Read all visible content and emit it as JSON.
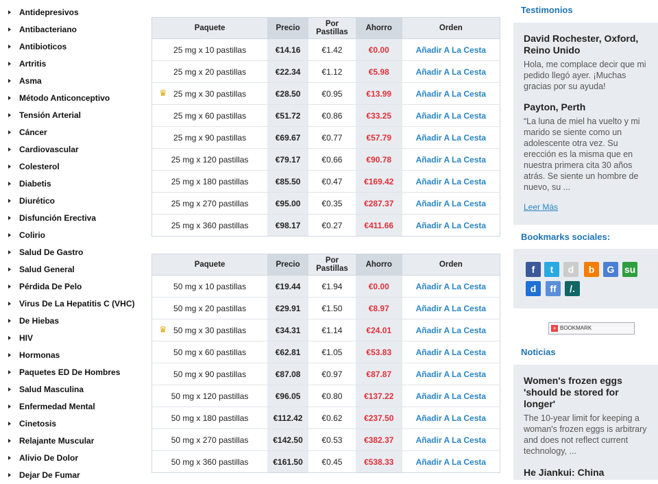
{
  "categories": [
    "Antidepresivos",
    "Antibacteriano",
    "Antibioticos",
    "Artritis",
    "Asma",
    "Método Anticonceptivo",
    "Tensión Arterial",
    "Cáncer",
    "Cardiovascular",
    "Colesterol",
    "Diabetis",
    "Diurético",
    "Disfunción Erectiva",
    "Colirio",
    "Salud De Gastro",
    "Salud General",
    "Pérdida De Pelo",
    "Virus De La Hepatitis C (VHC)",
    "De Hiebas",
    "HIV",
    "Hormonas",
    "Paquetes ED De Hombres",
    "Salud Masculina",
    "Enfermedad Mental",
    "Cinetosis",
    "Relajante Muscular",
    "Alivio De Dolor",
    "Dejar De Fumar"
  ],
  "table_headers": {
    "package": "Paquete",
    "price": "Precio",
    "per_pill": "Por Pastillas",
    "savings": "Ahorro",
    "order": "Orden"
  },
  "add_to_cart_label": "Añadir A La Cesta",
  "table1_rows": [
    {
      "package": "25 mg x 10 pastillas",
      "price": "€14.16",
      "per_pill": "€1.42",
      "savings": "€0.00",
      "crown": false
    },
    {
      "package": "25 mg x 20 pastillas",
      "price": "€22.34",
      "per_pill": "€1.12",
      "savings": "€5.98",
      "crown": false
    },
    {
      "package": "25 mg x 30 pastillas",
      "price": "€28.50",
      "per_pill": "€0.95",
      "savings": "€13.99",
      "crown": true
    },
    {
      "package": "25 mg x 60 pastillas",
      "price": "€51.72",
      "per_pill": "€0.86",
      "savings": "€33.25",
      "crown": false
    },
    {
      "package": "25 mg x 90 pastillas",
      "price": "€69.67",
      "per_pill": "€0.77",
      "savings": "€57.79",
      "crown": false
    },
    {
      "package": "25 mg x 120 pastillas",
      "price": "€79.17",
      "per_pill": "€0.66",
      "savings": "€90.78",
      "crown": false
    },
    {
      "package": "25 mg x 180 pastillas",
      "price": "€85.50",
      "per_pill": "€0.47",
      "savings": "€169.42",
      "crown": false
    },
    {
      "package": "25 mg x 270 pastillas",
      "price": "€95.00",
      "per_pill": "€0.35",
      "savings": "€287.37",
      "crown": false
    },
    {
      "package": "25 mg x 360 pastillas",
      "price": "€98.17",
      "per_pill": "€0.27",
      "savings": "€411.66",
      "crown": false
    }
  ],
  "table2_rows": [
    {
      "package": "50 mg x 10 pastillas",
      "price": "€19.44",
      "per_pill": "€1.94",
      "savings": "€0.00",
      "crown": false
    },
    {
      "package": "50 mg x 20 pastillas",
      "price": "€29.91",
      "per_pill": "€1.50",
      "savings": "€8.97",
      "crown": false
    },
    {
      "package": "50 mg x 30 pastillas",
      "price": "€34.31",
      "per_pill": "€1.14",
      "savings": "€24.01",
      "crown": true
    },
    {
      "package": "50 mg x 60 pastillas",
      "price": "€62.81",
      "per_pill": "€1.05",
      "savings": "€53.83",
      "crown": false
    },
    {
      "package": "50 mg x 90 pastillas",
      "price": "€87.08",
      "per_pill": "€0.97",
      "savings": "€87.87",
      "crown": false
    },
    {
      "package": "50 mg x 120 pastillas",
      "price": "€96.05",
      "per_pill": "€0.80",
      "savings": "€137.22",
      "crown": false
    },
    {
      "package": "50 mg x 180 pastillas",
      "price": "€112.42",
      "per_pill": "€0.62",
      "savings": "€237.50",
      "crown": false
    },
    {
      "package": "50 mg x 270 pastillas",
      "price": "€142.50",
      "per_pill": "€0.53",
      "savings": "€382.37",
      "crown": false
    },
    {
      "package": "50 mg x 360 pastillas",
      "price": "€161.50",
      "per_pill": "€0.45",
      "savings": "€538.33",
      "crown": false
    }
  ],
  "testimonials": {
    "heading": "Testimonios",
    "items": [
      {
        "name": "David Rochester, Oxford, Reino Unido",
        "text": "Hola, me complace decir que mi pedido llegó ayer. ¡Muchas gracias por su ayuda!"
      },
      {
        "name": "Payton, Perth",
        "text": "“La luna de miel ha vuelto y mi marido se siente como un adolescente otra vez. Su erección es la misma que en nuestra primera cita 30 años atrás. Se siente un hombre de nuevo, su ..."
      }
    ],
    "more_label": "Leer Más"
  },
  "social": {
    "heading": "Bookmarks sociales:",
    "icons": [
      {
        "name": "facebook-icon",
        "glyph": "f",
        "color": "#3b5998"
      },
      {
        "name": "twitter-icon",
        "glyph": "t",
        "color": "#29a9e1"
      },
      {
        "name": "digg-icon",
        "glyph": "d",
        "color": "#cccccc"
      },
      {
        "name": "blogger-icon",
        "glyph": "b",
        "color": "#f57d00"
      },
      {
        "name": "google-icon",
        "glyph": "G",
        "color": "#4a7fd4"
      },
      {
        "name": "stumbleupon-icon",
        "glyph": "su",
        "color": "#2e9e3e"
      },
      {
        "name": "delicious-icon",
        "glyph": "d",
        "color": "#1f6fd6"
      },
      {
        "name": "friendfeed-icon",
        "glyph": "ff",
        "color": "#5a8fd8"
      },
      {
        "name": "slashdot-icon",
        "glyph": "/.",
        "color": "#116666"
      }
    ],
    "bookmark_button_label": "BOOKMARK"
  },
  "news": {
    "heading": "Noticias",
    "items": [
      {
        "title": "Women's frozen eggs 'should be stored for longer'",
        "text": "The 10-year limit for keeping a woman's frozen eggs is arbitrary and does not reflect current technology, ..."
      },
      {
        "title": "He Jiankui: China",
        "text": ""
      }
    ]
  }
}
